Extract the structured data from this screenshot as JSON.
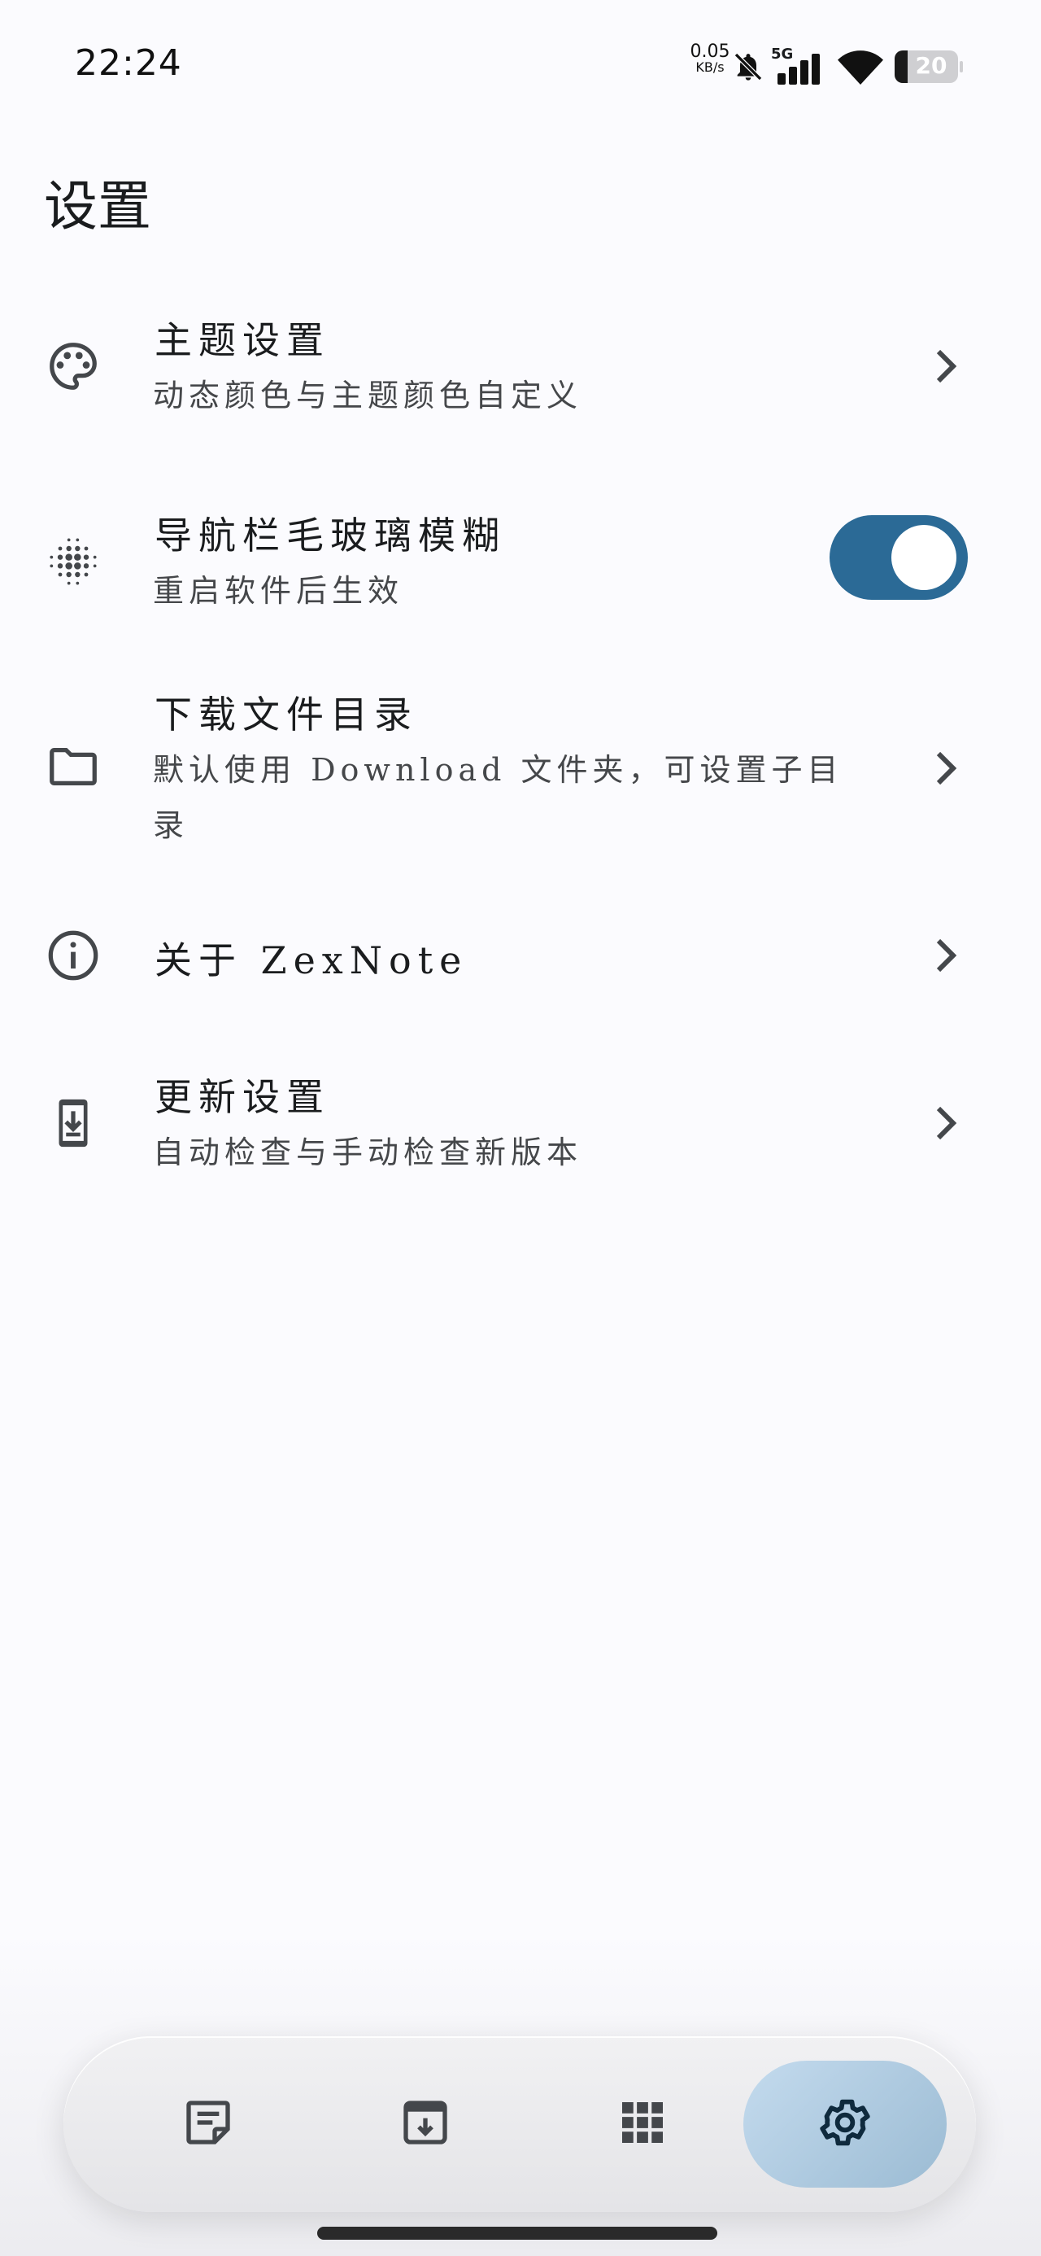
{
  "status_bar": {
    "time": "22:24",
    "net_speed_value": "0.05",
    "net_speed_unit": "KB/s",
    "network_type": "5G",
    "battery_level": "20"
  },
  "page": {
    "title": "设置"
  },
  "settings": {
    "theme": {
      "title": "主题设置",
      "subtitle": "动态颜色与主题颜色自定义",
      "icon": "palette-icon"
    },
    "blur": {
      "title": "导航栏毛玻璃模糊",
      "subtitle": "重启软件后生效",
      "icon": "blur-dots-icon",
      "enabled": true
    },
    "download": {
      "title": "下载文件目录",
      "subtitle": "默认使用 Download 文件夹，可设置子目录",
      "icon": "folder-icon"
    },
    "about": {
      "title": "关于 ZexNote",
      "icon": "info-icon"
    },
    "update": {
      "title": "更新设置",
      "subtitle": "自动检查与手动检查新版本",
      "icon": "system-update-icon"
    }
  },
  "bottom_nav": {
    "items": [
      {
        "name": "notes",
        "icon": "note-icon",
        "active": false
      },
      {
        "name": "archive",
        "icon": "archive-icon",
        "active": false
      },
      {
        "name": "apps",
        "icon": "apps-grid-icon",
        "active": false
      },
      {
        "name": "settings",
        "icon": "gear-icon",
        "active": true
      }
    ]
  },
  "colors": {
    "background": "#fbfbfe",
    "toggle_on": "#2b6a96",
    "nav_active": "#b1cbe0",
    "icon": "#44474b"
  }
}
